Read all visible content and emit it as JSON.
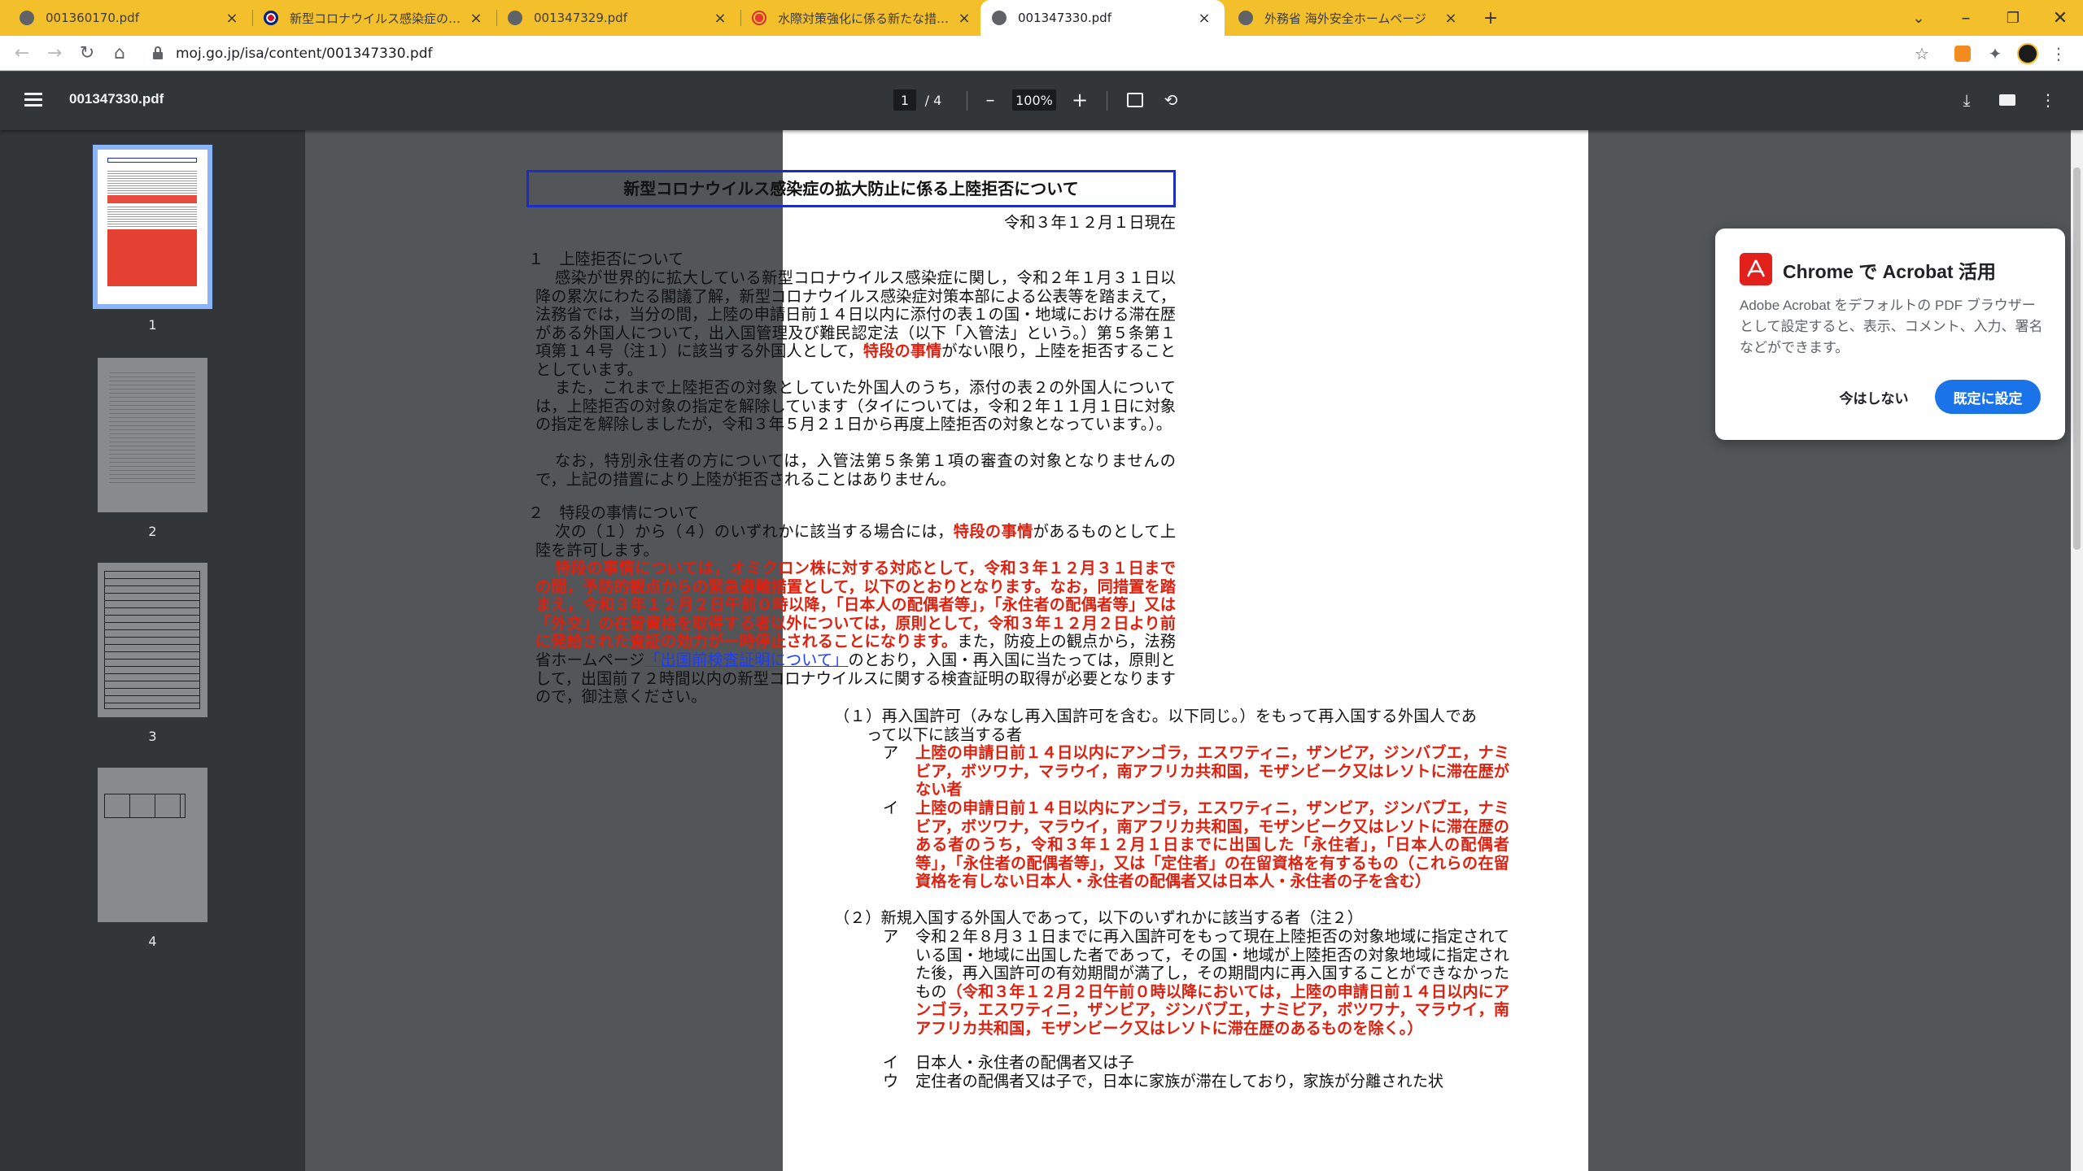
{
  "tabs": [
    {
      "title": "001360170.pdf",
      "icon": "globe-icon"
    },
    {
      "title": "新型コロナウイルス感染症の拡大防止",
      "icon": "uk-flag-icon"
    },
    {
      "title": "001347329.pdf",
      "icon": "globe-icon"
    },
    {
      "title": "水際対策強化に係る新たな措置（",
      "icon": "site-icon"
    },
    {
      "title": "001347330.pdf",
      "icon": "globe-icon"
    },
    {
      "title": "外務省 海外安全ホームページ",
      "icon": "globe-icon"
    }
  ],
  "toolbar": {
    "url": "moj.go.jp/isa/content/001347330.pdf"
  },
  "viewer": {
    "doc_title": "001347330.pdf",
    "page_current": "1",
    "page_total": "/ 4",
    "zoom": "100%"
  },
  "thumbnails": [
    "1",
    "2",
    "3",
    "4"
  ],
  "document": {
    "heading": "新型コロナウイルス感染症の拡大防止に係る上陸拒否について",
    "date": "令和３年１２月１日現在",
    "s1_title": "１　上陸拒否について",
    "p1a": "感染が世界的に拡大している新型コロナウイルス感染症に関し，令和２年１月３１日以降の累次にわたる閣議了解，新型コロナウイルス感染症対策本部による公表等を踏まえて，法務省では，当分の間，上陸の申請日前１４日以内に添付の表１の国・地域における滞在歴がある外国人について，出入国管理及び難民認定法（以下「入管法」という。）第５条第１項第１４号（注１）に該当する外国人として，",
    "p1a_red": "特段の事情",
    "p1a_end": "がない限り，上陸を拒否することとしています。",
    "p1b": "また，これまで上陸拒否の対象としていた外国人のうち，添付の表２の外国人については，上陸拒否の対象の指定を解除しています（タイについては，令和２年１１月１日に対象の指定を解除しましたが，令和３年５月２１日から再度上陸拒否の対象となっています。）。",
    "p1c": "なお，特別永住者の方については，入管法第５条第１項の審査の対象となりませんので，上記の措置により上陸が拒否されることはありません。",
    "s2_title": "２　特段の事情について",
    "p2a_1": "次の（１）から（４）のいずれかに該当する場合には，",
    "p2a_red": "特段の事情",
    "p2a_2": "があるものとして上陸を許可します。",
    "p2b_red": "特段の事情については，オミクロン株に対する対応として，令和３年１２月３１日までの間，予防的観点からの緊急避難措置として，以下のとおりとなります。なお，同措置を踏まえ，令和３年１２月２日午前０時以降，「日本人の配偶者等」，「永住者の配偶者等」又は「外交」の在留資格を取得する者以外については，原則として，令和３年１２月２日より前に発給された査証の効力が一時停止されることになります。",
    "p2b_2": "また，防疫上の観点から，法務省ホームページ",
    "p2b_link": "「出国前検査証明について」",
    "p2b_3": "のとおり，入国・再入国に当たっては，原則として，出国前７２時間以内の新型コロナウイルスに関する検査証明の取得が必要となりますので，御注意ください。",
    "i1": "（１）再入国許可（みなし再入国許可を含む。以下同じ。）をもって再入国する外国人であって以下に該当する者",
    "i1a_label": "ア",
    "i1a": "上陸の申請日前１４日以内にアンゴラ，エスワティニ，ザンビア，ジンバブエ，ナミビア，ボツワナ，マラウイ，南アフリカ共和国，モザンビーク又はレソトに滞在歴がない者",
    "i1b_label": "イ",
    "i1b": "上陸の申請日前１４日以内にアンゴラ，エスワティニ，ザンビア，ジンバブエ，ナミビア，ボツワナ，マラウイ，南アフリカ共和国，モザンビーク又はレソトに滞在歴のある者のうち，令和３年１２月１日までに出国した「永住者」，「日本人の配偶者等」，「永住者の配偶者等」，又は「定住者」の在留資格を有するもの（これらの在留資格を有しない日本人・永住者の配偶者又は日本人・永住者の子を含む）",
    "i2": "（２）新規入国する外国人であって，以下のいずれかに該当する者（注２）",
    "i2a_label": "ア",
    "i2a": "令和２年８月３１日までに再入国許可をもって現在上陸拒否の対象地域に指定されている国・地域に出国した者であって，その国・地域が上陸拒否の対象地域に指定された後，再入国許可の有効期間が満了し，その期間内に再入国することができなかったもの",
    "i2a_red": "（令和３年１２月２日午前０時以降においては，上陸の申請日前１４日以内にアンゴラ，エスワティニ，ザンビア，ジンバブエ，ナミビア，ボツワナ，マラウイ，南アフリカ共和国，モザンビーク又はレソトに滞在歴のあるものを除く。）",
    "i2b_label": "イ",
    "i2b": "日本人・永住者の配偶者又は子",
    "i2c_label": "ウ",
    "i2c": "定住者の配偶者又は子で，日本に家族が滞在しており，家族が分離された状"
  },
  "acrobat_popup": {
    "title": "Chrome で Acrobat 活用",
    "body": "Adobe Acrobat をデフォルトの PDF ブラウザーとして設定すると、表示、コメント、入力、署名などができます。",
    "later_label": "今はしない",
    "default_label": "既定に設定"
  },
  "colors": {
    "tabstrip": "#f3bf2b",
    "pdf_toolbar": "#323639",
    "accent": "#1a73e8",
    "doc_red": "#e0200f",
    "acrobat_red": "#e2211c"
  }
}
